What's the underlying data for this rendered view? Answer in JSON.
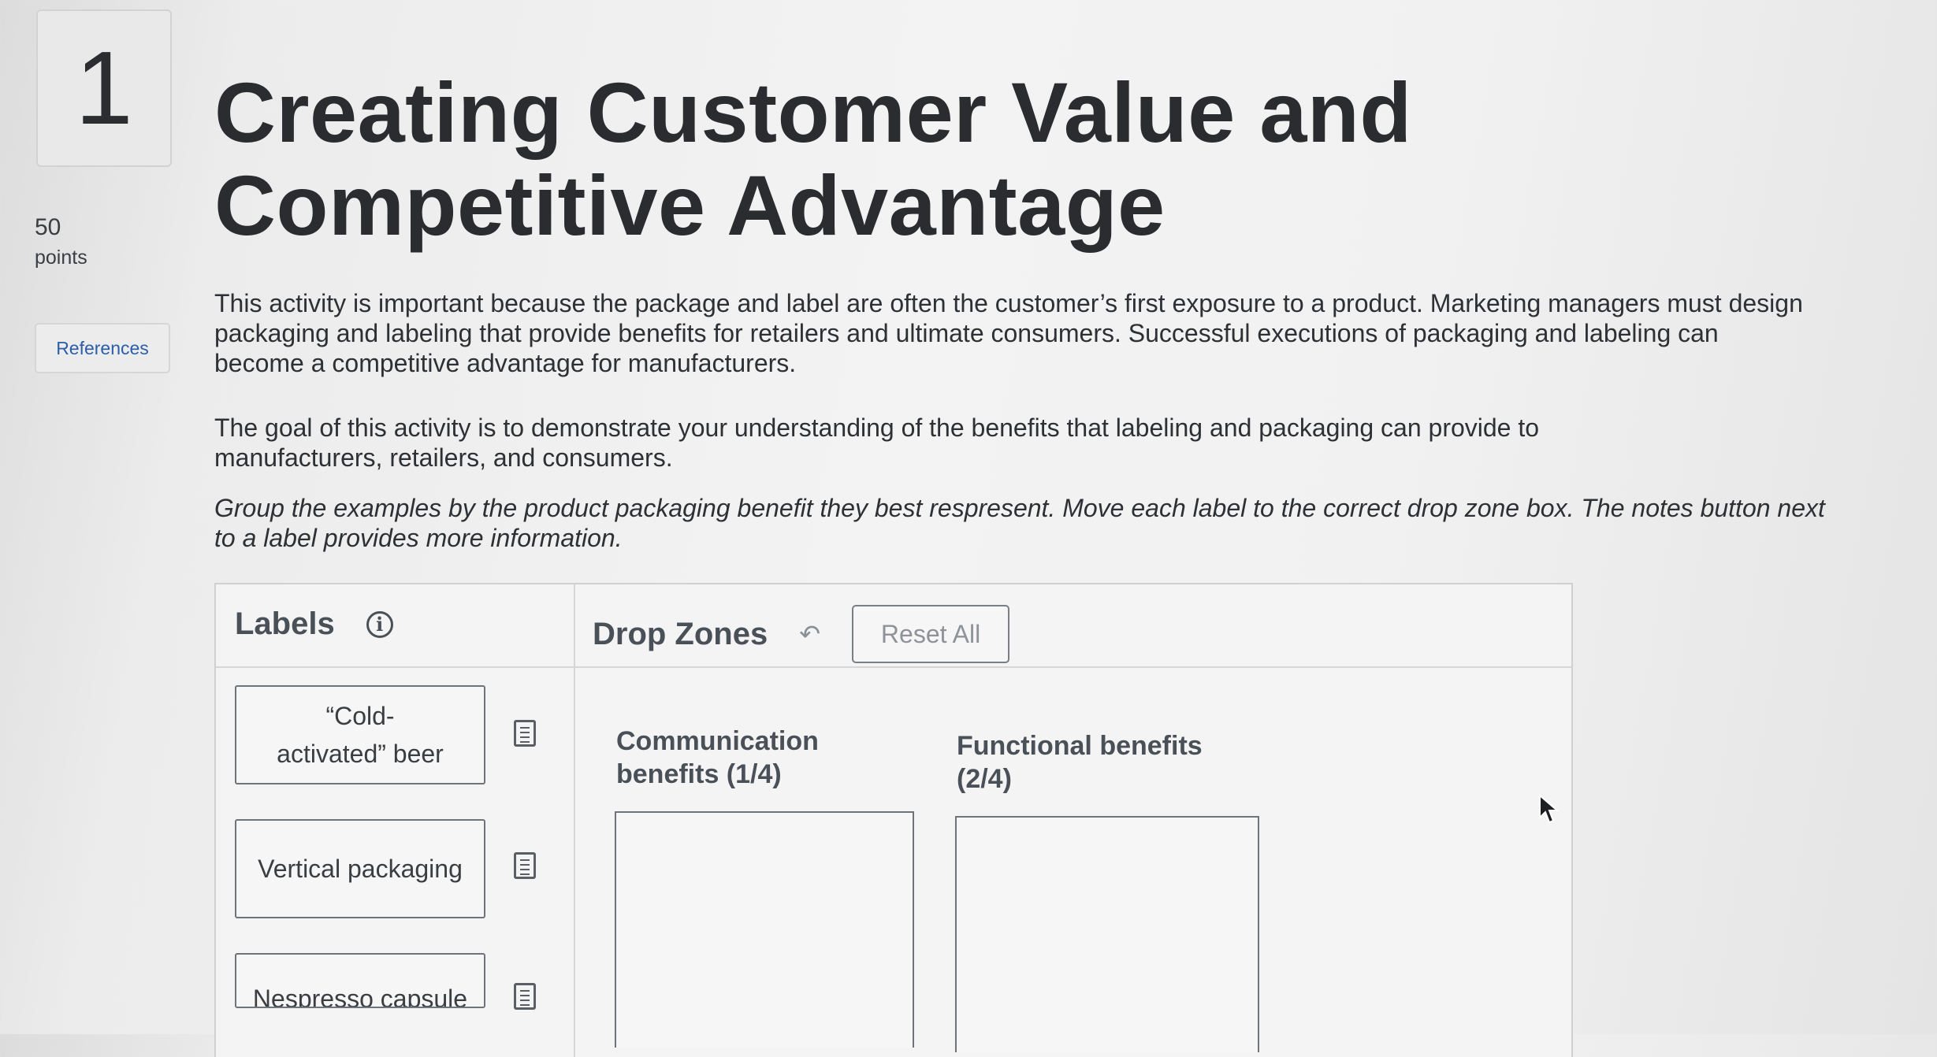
{
  "question": {
    "number": "1",
    "points_value": "50",
    "points_label": "points",
    "references_label": "References"
  },
  "title": "Creating Customer Value and Competitive Advantage",
  "paragraphs": {
    "intro": "This activity is important because the package and label are often the customer’s first exposure to a product. Marketing managers must design packaging and labeling that provide benefits for retailers and ultimate consumers. Successful executions of packaging and labeling can become a competitive advantage for manufacturers.",
    "goal": "The goal of this activity is to demonstrate your understanding of the benefits that labeling and packaging can provide to manufacturers, retailers, and consumers.",
    "instructions": "Group the examples by the product packaging benefit they best respresent. Move each label to the correct drop zone box. The notes button next to a label provides more information."
  },
  "labels_panel": {
    "title": "Labels",
    "info_icon": "info-icon",
    "items": [
      {
        "text": "“Cold-activated” beer",
        "note_icon": "notes-icon"
      },
      {
        "text": "Vertical packaging",
        "note_icon": "notes-icon"
      },
      {
        "text": "Nespresso capsule",
        "note_icon": "notes-icon"
      }
    ]
  },
  "drop_zones_panel": {
    "title": "Drop Zones",
    "undo_icon": "undo-icon",
    "reset_label": "Reset All",
    "zones": [
      {
        "title": "Communication benefits (1/4)"
      },
      {
        "title": "Functional benefits (2/4)"
      }
    ]
  },
  "colors": {
    "link": "#2c5ea8",
    "text": "#2f3236",
    "panel_heading": "#4a5058",
    "border": "#6f747a"
  }
}
